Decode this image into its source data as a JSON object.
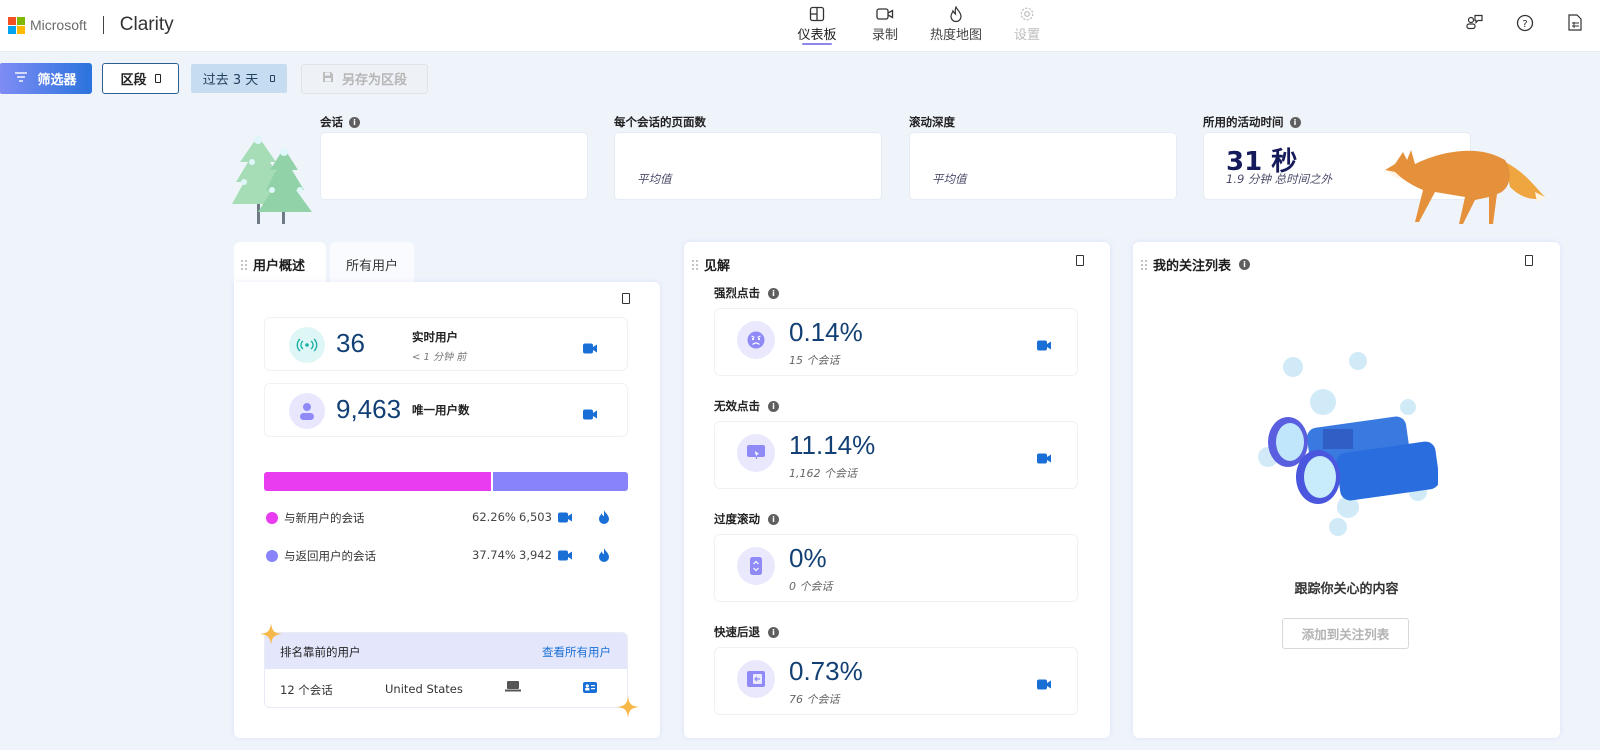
{
  "header": {
    "brand": "Microsoft",
    "product": "Clarity",
    "nav": [
      {
        "label": "仪表板",
        "icon": "dashboard-icon",
        "active": true
      },
      {
        "label": "录制",
        "icon": "video-icon",
        "active": false
      },
      {
        "label": "热度地图",
        "icon": "flame-icon",
        "active": false
      },
      {
        "label": "设置",
        "icon": "gear-icon",
        "disabled": true
      }
    ],
    "right_icons": [
      "feedback-icon",
      "help-icon",
      "document-icon"
    ]
  },
  "toolbar": {
    "filter_label": "筛选器",
    "segment_label": "区段",
    "date_label": "过去 3 天",
    "save_label": "另存为区段"
  },
  "kpis": [
    {
      "label": "会话",
      "info": true,
      "value": "",
      "sub": ""
    },
    {
      "label": "每个会话的页面数",
      "info": false,
      "value": "",
      "sub": "平均值"
    },
    {
      "label": "滚动深度",
      "info": false,
      "value": "",
      "sub": "平均值"
    },
    {
      "label": "所用的活动时间",
      "info": true,
      "value": "31 秒",
      "sub": "1.9 分钟 总时间之外"
    }
  ],
  "user_overview": {
    "tabs": [
      "用户概述",
      "所有用户"
    ],
    "live_users": {
      "value": "36",
      "label": "实时用户",
      "sub": "< 1 分钟 前"
    },
    "unique_users": {
      "value": "9,463",
      "label": "唯一用户数"
    },
    "split": {
      "colors": {
        "new": "#e93cf0",
        "returning": "#8883f8"
      },
      "new": {
        "label": "与新用户的会话",
        "percent": "62.26%",
        "fraction": 0.6226,
        "count": "6,503"
      },
      "returning": {
        "label": "与返回用户的会话",
        "percent": "37.74%",
        "fraction": 0.3774,
        "count": "3,942"
      }
    },
    "top_users": {
      "title": "排名靠前的用户",
      "link": "查看所有用户",
      "row": {
        "sessions": "12 个会话",
        "country": "United States",
        "device": "laptop-icon",
        "profile": "contact-card-icon"
      }
    }
  },
  "insights": {
    "title": "见解",
    "items": [
      {
        "label": "强烈点击",
        "value": "0.14%",
        "sub": "15 个会话",
        "icon": "angry-face-icon",
        "recording": true
      },
      {
        "label": "无效点击",
        "value": "11.14%",
        "sub": "1,162 个会话",
        "icon": "cursor-click-icon",
        "recording": true
      },
      {
        "label": "过度滚动",
        "value": "0%",
        "sub": "0 个会话",
        "icon": "scroll-icon",
        "recording": false
      },
      {
        "label": "快速后退",
        "value": "0.73%",
        "sub": "76 个会话",
        "icon": "back-arrow-icon",
        "recording": true
      }
    ]
  },
  "watchlist": {
    "title": "我的关注列表",
    "empty_text": "跟踪你关心的内容",
    "add_button": "添加到关注列表"
  }
}
